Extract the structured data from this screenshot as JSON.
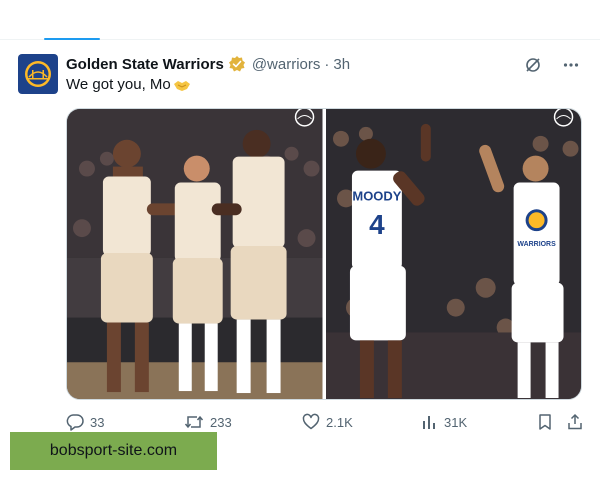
{
  "tweet": {
    "author_name": "Golden State Warriors",
    "handle": "@warriors",
    "separator": "·",
    "time": "3h",
    "text": "We got you, Mo",
    "emoji": "handshake",
    "avatar_icon": "warriors-bridge-logo",
    "verified_color": "#e2b33c",
    "media": [
      {
        "icon": "photo-team-handshake",
        "description_icon": "warriors-logo"
      },
      {
        "icon": "photo-high-five",
        "jersey_name": "MOODY",
        "jersey_number": "4",
        "other_jersey": "WARRIORS"
      }
    ]
  },
  "actions": {
    "replies": "33",
    "retweets": "233",
    "likes": "2.1K",
    "views": "31K"
  },
  "watermark": {
    "text": "bobsport-site.com",
    "color": "#7cab4f"
  },
  "colors": {
    "accent": "#1d9bf0",
    "text_secondary": "#536471",
    "team_navy": "#1d428a",
    "team_gold": "#fdb927"
  }
}
